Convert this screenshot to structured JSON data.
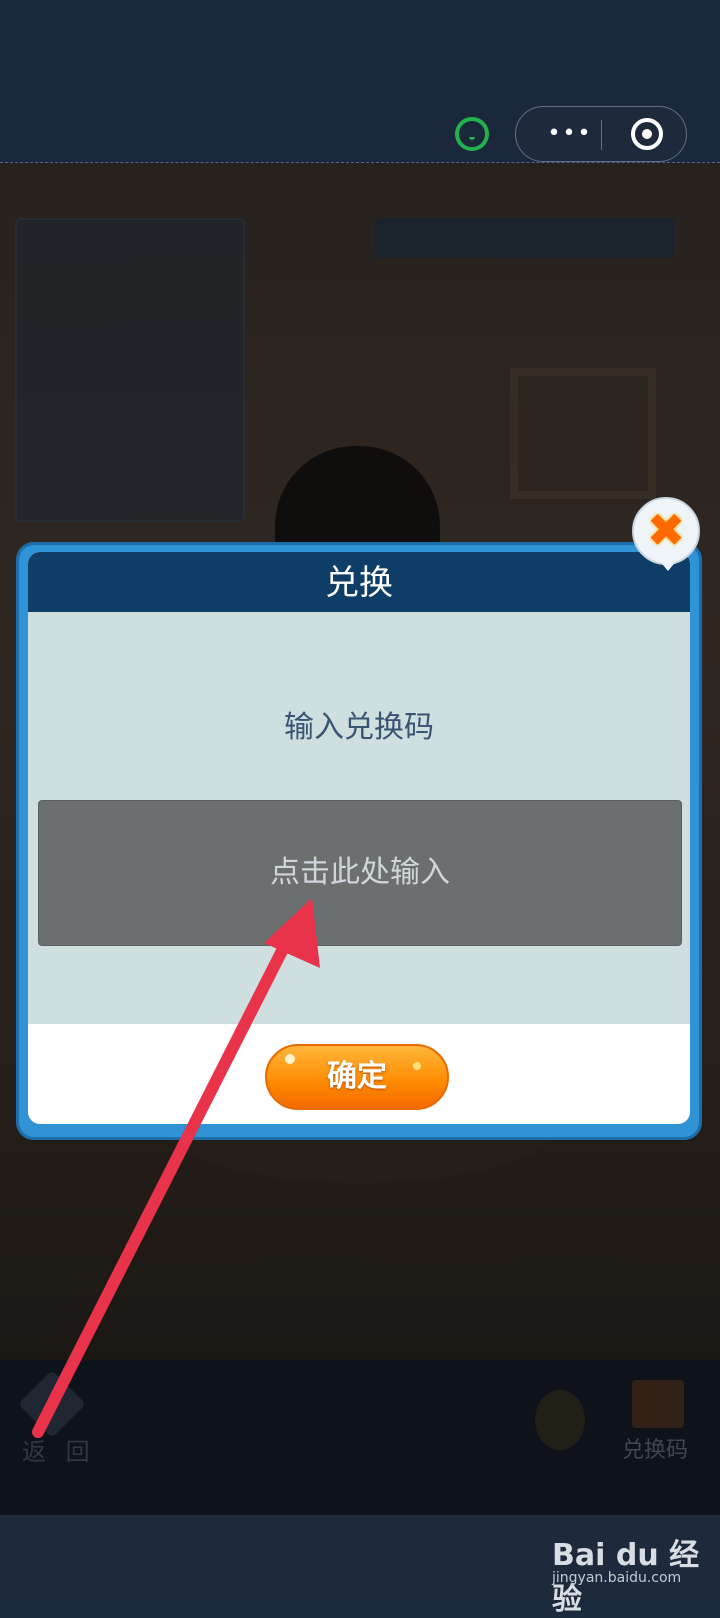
{
  "header": {
    "capsule_more_icon": "more-dots-icon",
    "capsule_target_icon": "target-icon",
    "status_icon": "green-smile-icon"
  },
  "dialog": {
    "title": "兑换",
    "prompt": "输入兑换码",
    "input_placeholder": "点击此处输入",
    "confirm_label": "确定",
    "close_icon": "close-icon"
  },
  "bottombar": {
    "back_label": "返 回",
    "exchange_label": "兑换码"
  },
  "watermark": {
    "brand": "Bai du 经验",
    "url": "jingyan.baidu.com"
  },
  "colors": {
    "dialog_header": "#0e3d68",
    "dialog_border": "#2f93d6",
    "confirm": "#ff8a00",
    "annotation_arrow": "#e8334a"
  }
}
